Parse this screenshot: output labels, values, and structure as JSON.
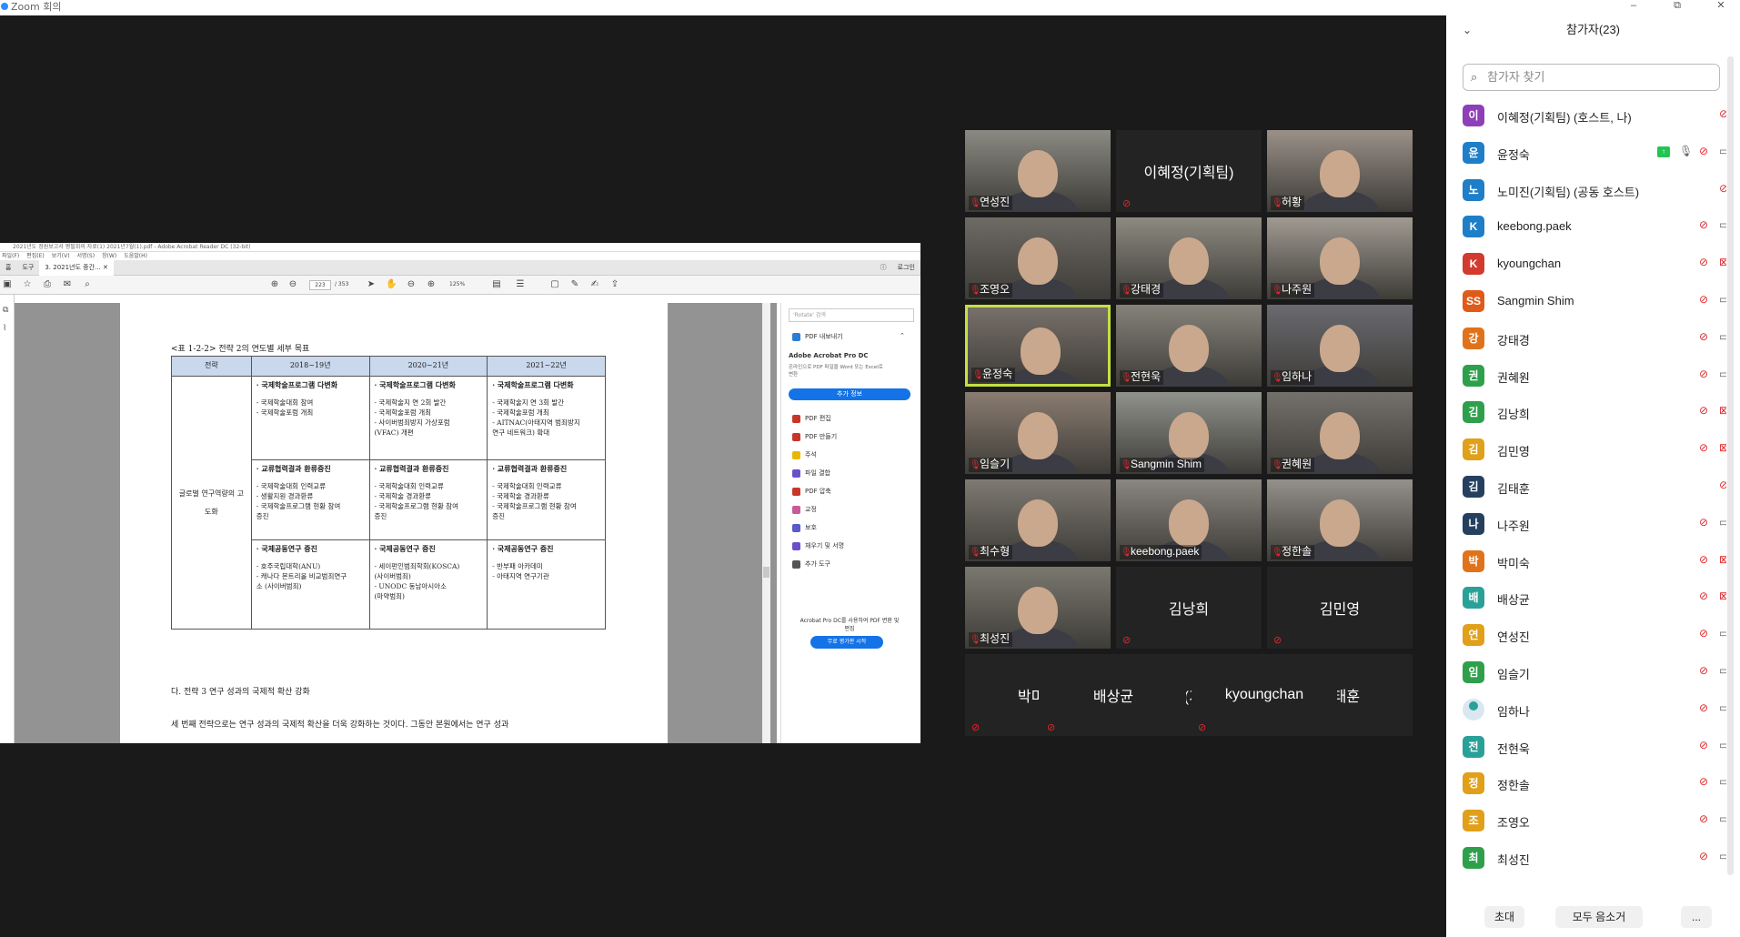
{
  "window": {
    "title": "Zoom 회의"
  },
  "acrobat": {
    "title": "2021년도 정원보고서 평필회의 자료(1) 2021년7월(1).pdf - Adobe Acrobat Reader DC (32-bit)",
    "menu": [
      "파일(F)",
      "편집(E)",
      "보기(V)",
      "서명(S)",
      "창(W)",
      "도움말(H)"
    ],
    "tabs": [
      "홈",
      "도구",
      "3. 2021년도 중간..."
    ],
    "page_current": "223",
    "page_total": "/ 353",
    "zoom": "125%",
    "login": "로그인",
    "right_panel": {
      "search_placeholder": "'Rotate' 검색",
      "export_pdf": "PDF 내보내기",
      "product": "Adobe Acrobat Pro DC",
      "product_desc": "온라인으로 PDF 파일을 Word 또는 Excel로 변환",
      "more_info": "추가 정보",
      "tools": [
        "PDF 편집",
        "PDF 만들기",
        "주석",
        "파일 결합",
        "PDF 압축",
        "교정",
        "보호",
        "채우기 및 서명",
        "추가 도구"
      ],
      "promo": "Acrobat Pro DC를 사용하여 PDF 변환 및 편집",
      "trial": "무료 평가판 시작"
    }
  },
  "document": {
    "caption": "<표 1-2-2> 전략 2의 연도별 세부 목표",
    "headers": [
      "전략",
      "2018~19년",
      "2020~21년",
      "2021~22년"
    ],
    "strategy": "글로벌 연구역량의 고도화",
    "rows": [
      {
        "c1_title": "· 국제학술프로그램 다변화",
        "c1_body": "- 국제학술대회 참여\n- 국제학술포럼 개최",
        "c2_title": "· 국제학술프로그램 다변화",
        "c2_body": "- 국제학술지 연 2회 발간\n- 국제학술포럼 개최\n- 사이버범죄방지 가상포럼\n  (VFAC) 개편",
        "c3_title": "· 국제학술프로그램 다변화",
        "c3_body": "- 국제학술지 연 3회 발간\n- 국제학술포럼 개최\n- AITNAC(아태지역 범죄방지\n  연구 네트워크) 확대"
      },
      {
        "c1_title": "· 교류협력결과 환류증진",
        "c1_body": "- 국제학술대회 인력교류\n- 생활지원 경과환류\n- 국제학술프로그램 현황 참여\n  증진",
        "c2_title": "· 교류협력결과 환류증진",
        "c2_body": "- 국제학술대회 인력교류\n- 국제학술 경과환류\n- 국제학술프로그램 현황 참여\n  증진",
        "c3_title": "· 교류협력결과 환류증진",
        "c3_body": "- 국제학술대회 인력교류\n- 국제학술 경과환류\n- 국제학술프로그램 현황 참여\n  증진"
      },
      {
        "c1_title": "· 국제공동연구 증진",
        "c1_body": "- 호주국립대학(ANU)\n- 캐나다 몬트리올 비교범죄연구\n  소 (사이버범죄)",
        "c2_title": "· 국제공동연구 증진",
        "c2_body": "- 세이펀인범죄학회(KOSCA)\n  (사이버범죄)\n- UNODC 동남아시아소\n  (마약범죄)",
        "c3_title": "· 국제공동연구 증진",
        "c3_body": "- 반부패 아카데미\n- 아태지역 연구기관"
      }
    ],
    "section": "다. 전략 3 연구 성과의 국제적 확산 강화",
    "paragraph": "세 번째 전략으로는 연구 성과의 국제적 확산을 더욱 강화하는 것이다. 그동안 본원에서는 연구 성과"
  },
  "gallery": [
    {
      "name": "연성진",
      "video": true
    },
    {
      "name": "이혜정(기획팀)",
      "video": false
    },
    {
      "name": "허황",
      "video": true
    },
    {
      "name": "조영오",
      "video": true
    },
    {
      "name": "강태경",
      "video": true
    },
    {
      "name": "나주원",
      "video": true
    },
    {
      "name": "윤정숙",
      "video": true,
      "active": true
    },
    {
      "name": "전현욱",
      "video": true
    },
    {
      "name": "임하나",
      "video": true
    },
    {
      "name": "임슬기",
      "video": true
    },
    {
      "name": "Sangmin Shim",
      "video": true
    },
    {
      "name": "권혜원",
      "video": true
    },
    {
      "name": "최수형",
      "video": true
    },
    {
      "name": "keebong.paek",
      "video": true
    },
    {
      "name": "정한솔",
      "video": true
    },
    {
      "name": "최성진",
      "video": true
    },
    {
      "name": "김낭희",
      "video": false
    },
    {
      "name": "김민영",
      "video": false
    },
    {
      "name": "박미숙",
      "video": false
    },
    {
      "name": "노미진(기획팀)",
      "video": false
    },
    {
      "name": "김태훈",
      "video": false
    },
    {
      "name": "배상균",
      "video": false
    },
    {
      "name": "kyoungchan",
      "video": false
    }
  ],
  "participants": {
    "title": "참가자(23)",
    "search_placeholder": "참가자 찾기",
    "list": [
      {
        "avatar": "이",
        "color": "#8e3fb8",
        "name": "이혜정(기획팀) (호스트, 나)",
        "cam": "none"
      },
      {
        "avatar": "윤",
        "color": "#1e7ec8",
        "name": "윤정숙",
        "cam": "on",
        "sharing": true
      },
      {
        "avatar": "노",
        "color": "#1e7ec8",
        "name": "노미진(기획팀) (공동 호스트)",
        "cam": "none"
      },
      {
        "avatar": "K",
        "color": "#1e7ec8",
        "name": "keebong.paek",
        "cam": "on"
      },
      {
        "avatar": "K",
        "color": "#d23b2d",
        "name": "kyoungchan",
        "cam": "off"
      },
      {
        "avatar": "SS",
        "color": "#e05a1a",
        "name": "Sangmin Shim",
        "cam": "on"
      },
      {
        "avatar": "강",
        "color": "#e0731a",
        "name": "강태경",
        "cam": "on"
      },
      {
        "avatar": "권",
        "color": "#2ea04c",
        "name": "권혜원",
        "cam": "on"
      },
      {
        "avatar": "김",
        "color": "#2ea04c",
        "name": "김낭희",
        "cam": "off"
      },
      {
        "avatar": "김",
        "color": "#e0a01a",
        "name": "김민영",
        "cam": "off"
      },
      {
        "avatar": "김",
        "color": "#25405e",
        "name": "김태훈",
        "cam": "none"
      },
      {
        "avatar": "나",
        "color": "#25405e",
        "name": "나주원",
        "cam": "on"
      },
      {
        "avatar": "박",
        "color": "#e0731a",
        "name": "박미숙",
        "cam": "off"
      },
      {
        "avatar": "배",
        "color": "#2aa198",
        "name": "배상균",
        "cam": "off"
      },
      {
        "avatar": "연",
        "color": "#e0a01a",
        "name": "연성진",
        "cam": "on"
      },
      {
        "avatar": "임",
        "color": "#2ea04c",
        "name": "임슬기",
        "cam": "on"
      },
      {
        "avatar": "",
        "color": "#2aa198",
        "name": "임하나",
        "cam": "on",
        "photo": true
      },
      {
        "avatar": "전",
        "color": "#2aa198",
        "name": "전현욱",
        "cam": "on"
      },
      {
        "avatar": "정",
        "color": "#e0a01a",
        "name": "정한솔",
        "cam": "on"
      },
      {
        "avatar": "조",
        "color": "#e0a01a",
        "name": "조영오",
        "cam": "on"
      },
      {
        "avatar": "최",
        "color": "#2ea04c",
        "name": "최성진",
        "cam": "on"
      }
    ],
    "footer": {
      "invite": "초대",
      "mute_all": "모두 음소거",
      "more": "..."
    }
  },
  "colors": {
    "muted": "#e0282d",
    "active_speaker": "#c4e042",
    "zoom_blue": "#2d8cff"
  }
}
